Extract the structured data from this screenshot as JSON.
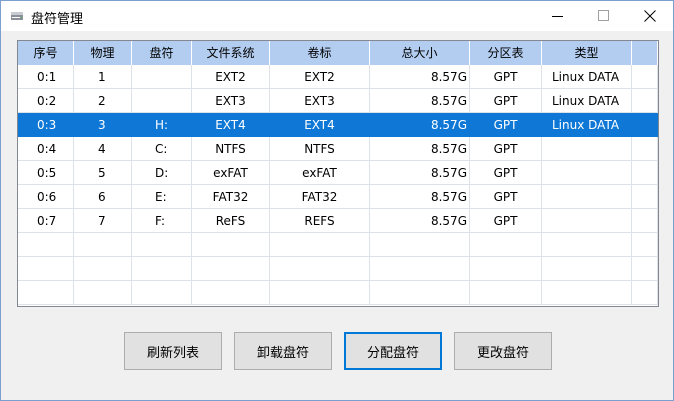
{
  "window": {
    "title": "盘符管理"
  },
  "table": {
    "columns": [
      "序号",
      "物理",
      "盘符",
      "文件系统",
      "卷标",
      "总大小",
      "分区表",
      "类型"
    ],
    "rows": [
      [
        "0:1",
        "1",
        "",
        "EXT2",
        "EXT2",
        "8.57G",
        "GPT",
        "Linux DATA"
      ],
      [
        "0:2",
        "2",
        "",
        "EXT3",
        "EXT3",
        "8.57G",
        "GPT",
        "Linux DATA"
      ],
      [
        "0:3",
        "3",
        "H:",
        "EXT4",
        "EXT4",
        "8.57G",
        "GPT",
        "Linux DATA"
      ],
      [
        "0:4",
        "4",
        "C:",
        "NTFS",
        "NTFS",
        "8.57G",
        "GPT",
        ""
      ],
      [
        "0:5",
        "5",
        "D:",
        "exFAT",
        "exFAT",
        "8.57G",
        "GPT",
        ""
      ],
      [
        "0:6",
        "6",
        "E:",
        "FAT32",
        "FAT32",
        "8.57G",
        "GPT",
        ""
      ],
      [
        "0:7",
        "7",
        "F:",
        "ReFS",
        "REFS",
        "8.57G",
        "GPT",
        ""
      ]
    ],
    "selected_row": 2,
    "empty_rows": 3
  },
  "buttons": {
    "refresh": "刷新列表",
    "unmount": "卸载盘符",
    "assign": "分配盘符",
    "change": "更改盘符"
  },
  "colors": {
    "selection": "#0f78d7",
    "header": "#b3cdf0"
  },
  "icons": {
    "app": "drive-icon",
    "minimize": "minimize-icon",
    "maximize": "maximize-icon",
    "close": "close-icon"
  }
}
